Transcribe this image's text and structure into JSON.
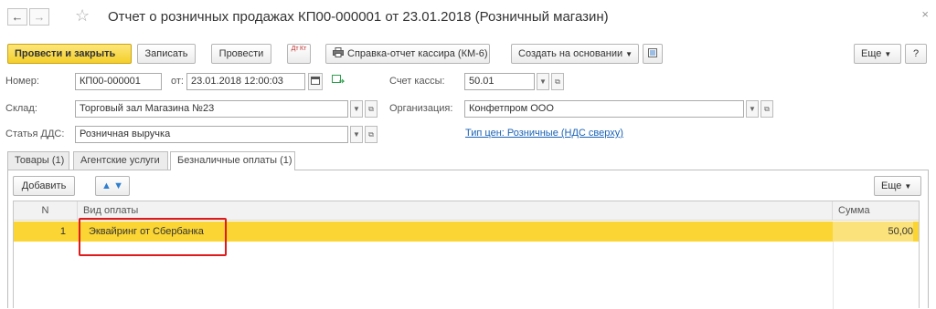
{
  "window": {
    "back_icon": "←",
    "forward_icon": "→",
    "star_icon": "☆",
    "title": "Отчет о розничных продажах КП00-000001 от 23.01.2018 (Розничный магазин)",
    "close_icon": "×"
  },
  "toolbar": {
    "post_close": "Провести и закрыть",
    "save": "Записать",
    "post": "Провести",
    "dt_kt": "Дт Кт",
    "cashier_report": "Справка-отчет кассира (КМ-6)",
    "create_based_on": "Создать на основании",
    "more": "Еще",
    "help": "?"
  },
  "form": {
    "number_label": "Номер:",
    "number_value": "КП00-000001",
    "date_label": "от:",
    "date_value": "23.01.2018 12:00:03",
    "account_label": "Счет кассы:",
    "account_value": "50.01",
    "warehouse_label": "Склад:",
    "warehouse_value": "Торговый зал Магазина №23",
    "org_label": "Организация:",
    "org_value": "Конфетпром ООО",
    "dds_label": "Статья ДДС:",
    "dds_value": "Розничная выручка",
    "price_type_link": "Тип цен: Розничные (НДС сверху)"
  },
  "tabs": [
    {
      "label": "Товары (1)"
    },
    {
      "label": "Агентские услуги"
    },
    {
      "label": "Безналичные оплаты (1)"
    }
  ],
  "table_toolbar": {
    "add": "Добавить",
    "up_icon": "🡅",
    "down_icon": "🡇",
    "more": "Еще"
  },
  "table": {
    "columns": [
      "N",
      "Вид оплаты",
      "Сумма"
    ],
    "rows": [
      {
        "n": "1",
        "payment_type": "Эквайринг от Сбербанка",
        "amount": "50,00"
      }
    ]
  },
  "colors": {
    "accent_yellow": "#fbd533",
    "primary_button": "#f4cf2a",
    "highlight_red": "#e0191a",
    "link_blue": "#1a62b5"
  }
}
